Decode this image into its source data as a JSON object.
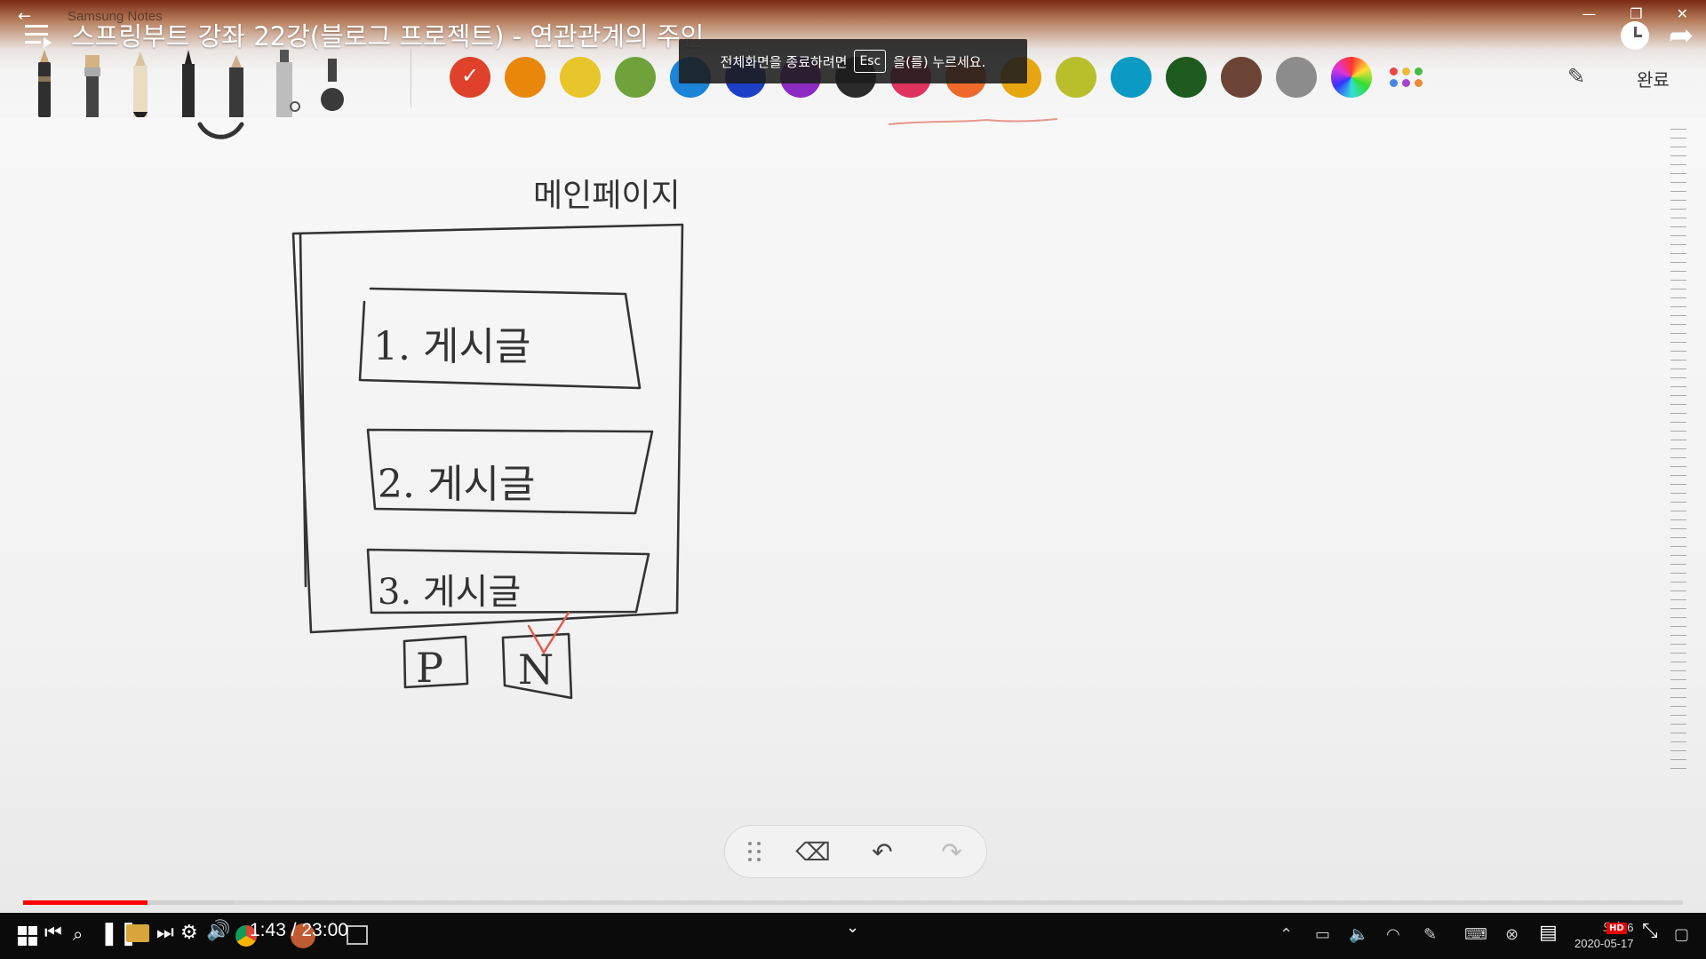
{
  "window": {
    "app_name": "Samsung Notes",
    "back_glyph": "←",
    "controls": [
      "—",
      "❐",
      "✕"
    ]
  },
  "video": {
    "title": "스프링부트 강좌 22강(블로그 프로젝트) - 연관관계의 주인",
    "time": "1:43 / 23:00",
    "progress_fraction": 0.0747,
    "buffer_fraction": 0.1267,
    "hd_badge": "HD"
  },
  "esc_hint": {
    "before": "전체화면을 종료하려면",
    "key": "Esc",
    "after": "을(를) 누르세요."
  },
  "toolbar": {
    "done_label": "완료",
    "colors": [
      "#e0412b",
      "#e9870a",
      "#e8c52a",
      "#6fa23a",
      "#1a84d6",
      "#1d3fc5",
      "#8b2bc3",
      "#2b2b2b",
      "#e0325e",
      "#ee6a2a",
      "#e7a60f",
      "#b8bf2a",
      "#0a9ac4",
      "#1e5b1e",
      "#6b4435",
      "#8c8c8c"
    ],
    "selected_color_index": 0
  },
  "notes": {
    "page_title": "메인페이지",
    "post_1": "1. 게시글",
    "post_2": "2. 게시글",
    "post_3": "3. 게시글",
    "prev_button": "P",
    "next_button": "N"
  },
  "taskbar": {
    "clock_time": "오후 6",
    "clock_date": "2020-05-17"
  }
}
